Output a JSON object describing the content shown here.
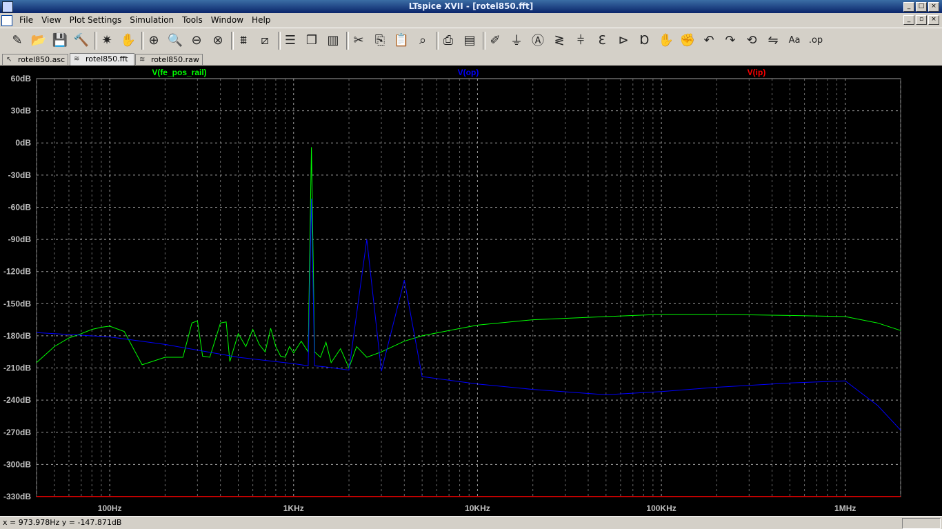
{
  "window": {
    "title": "LTspice XVII - [rotel850.fft]"
  },
  "menu": [
    "File",
    "View",
    "Plot Settings",
    "Simulation",
    "Tools",
    "Window",
    "Help"
  ],
  "toolbar_icons": [
    "new-schematic-icon",
    "open-icon",
    "save-icon",
    "control-panel-icon",
    "run-icon",
    "pan-icon",
    "zoom-in-icon",
    "zoom-area-icon",
    "zoom-out-icon",
    "zoom-cancel-icon",
    "autorange-icon",
    "fft-icon",
    "tile-horizontal-icon",
    "cascade-icon",
    "tile-vertical-icon",
    "cut-icon",
    "copy-icon",
    "paste-icon",
    "find-icon",
    "print-icon",
    "print-preview-icon",
    "wire-icon",
    "ground-icon",
    "label-icon",
    "resistor-icon",
    "capacitor-icon",
    "inductor-icon",
    "diode-icon",
    "component-icon",
    "move-icon",
    "drag-icon",
    "undo-icon",
    "redo-icon",
    "rotate-icon",
    "mirror-icon",
    "text-icon",
    "spice-directive-icon"
  ],
  "tabs": [
    {
      "label": "rotel850.asc",
      "icon": "schematic-tab-icon",
      "active": false
    },
    {
      "label": "rotel850.fft",
      "icon": "waveform-tab-icon",
      "active": true
    },
    {
      "label": "rotel850.raw",
      "icon": "waveform-tab-icon",
      "active": false
    }
  ],
  "status": {
    "cursor": "x = 973.978Hz    y = -147.871dB"
  },
  "chart_data": {
    "type": "line",
    "x_scale": "log",
    "xlim": [
      40,
      2000000
    ],
    "ylim": [
      -330,
      60
    ],
    "grid": true,
    "x_ticks": [
      {
        "value": 100,
        "label": "100Hz"
      },
      {
        "value": 1000,
        "label": "1KHz"
      },
      {
        "value": 10000,
        "label": "10KHz"
      },
      {
        "value": 100000,
        "label": "100KHz"
      },
      {
        "value": 1000000,
        "label": "1MHz"
      }
    ],
    "y_ticks": [
      {
        "value": 60,
        "label": "60dB"
      },
      {
        "value": 30,
        "label": "30dB"
      },
      {
        "value": 0,
        "label": "0dB"
      },
      {
        "value": -30,
        "label": "-30dB"
      },
      {
        "value": -60,
        "label": "-60dB"
      },
      {
        "value": -90,
        "label": "-90dB"
      },
      {
        "value": -120,
        "label": "-120dB"
      },
      {
        "value": -150,
        "label": "-150dB"
      },
      {
        "value": -180,
        "label": "-180dB"
      },
      {
        "value": -210,
        "label": "-210dB"
      },
      {
        "value": -240,
        "label": "-240dB"
      },
      {
        "value": -270,
        "label": "-270dB"
      },
      {
        "value": -300,
        "label": "-300dB"
      },
      {
        "value": -330,
        "label": "-330dB"
      }
    ],
    "series": [
      {
        "name": "V(fe_pos_rail)",
        "color": "#00ff00",
        "x": [
          40,
          50,
          60,
          70,
          80,
          90,
          100,
          120,
          150,
          200,
          250,
          280,
          300,
          320,
          350,
          400,
          430,
          450,
          500,
          550,
          600,
          650,
          700,
          750,
          800,
          850,
          900,
          950,
          1000,
          1100,
          1200,
          1250,
          1300,
          1400,
          1500,
          1600,
          1800,
          2000,
          2200,
          2500,
          3000,
          4000,
          5000,
          7000,
          10000,
          20000,
          50000,
          100000,
          200000,
          500000,
          1000000,
          1500000,
          2000000
        ],
        "y": [
          -205,
          -190,
          -182,
          -178,
          -174,
          -172,
          -171,
          -176,
          -207,
          -200,
          -200,
          -168,
          -166,
          -199,
          -200,
          -168,
          -167,
          -204,
          -178,
          -190,
          -174,
          -188,
          -195,
          -173,
          -190,
          -199,
          -200,
          -190,
          -196,
          -185,
          -195,
          -4,
          -195,
          -200,
          -186,
          -205,
          -192,
          -210,
          -190,
          -200,
          -195,
          -185,
          -180,
          -175,
          -170,
          -165,
          -162,
          -160,
          -160,
          -161,
          -162,
          -168,
          -175
        ]
      },
      {
        "name": "V(op)",
        "color": "#0000ff",
        "x": [
          40,
          100,
          200,
          500,
          1000,
          1200,
          1250,
          1300,
          1500,
          2000,
          2500,
          3000,
          4000,
          5000,
          10000,
          20000,
          50000,
          100000,
          200000,
          500000,
          1000000,
          1500000,
          2000000
        ],
        "y": [
          -177,
          -181,
          -188,
          -200,
          -206,
          -208,
          -52,
          -208,
          -209,
          -212,
          -90,
          -213,
          -128,
          -218,
          -225,
          -230,
          -235,
          -232,
          -228,
          -224,
          -222,
          -245,
          -268
        ]
      },
      {
        "name": "V(ip)",
        "color": "#ff0000",
        "x": [
          40,
          2000000
        ],
        "y": [
          -330,
          -330
        ]
      }
    ]
  }
}
